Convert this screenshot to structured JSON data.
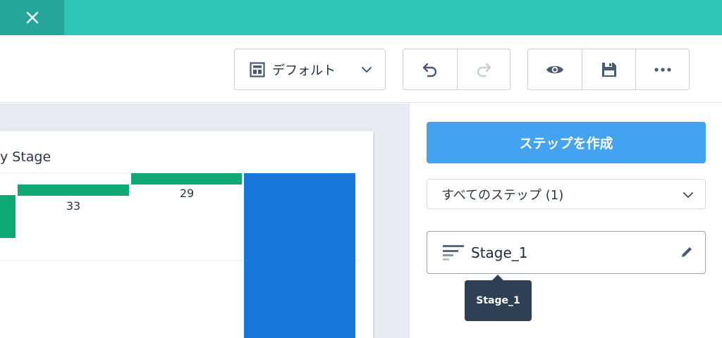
{
  "topbar": {
    "close_icon": "close-icon"
  },
  "toolbar": {
    "layout_dropdown": {
      "label": "デフォルト",
      "icon": "layout-icon"
    },
    "history": {
      "undo_icon": "undo-icon",
      "redo_icon": "redo-icon"
    },
    "actions": {
      "preview_icon": "eye-icon",
      "save_icon": "save-icon",
      "more_icon": "more-icon"
    }
  },
  "chart": {
    "title": "y Stage",
    "data_labels": [
      "33",
      "29"
    ]
  },
  "chart_data": {
    "type": "bar",
    "title": "y Stage",
    "data_labels": [
      "33",
      "29"
    ]
  },
  "right_panel": {
    "create_step_label": "ステップを作成",
    "steps_filter_label": "すべてのステップ (1)",
    "step": {
      "name": "Stage_1",
      "icon": "filter-lines-icon"
    },
    "tooltip": "Stage_1"
  },
  "colors": {
    "teal": "#2ec4b6",
    "green": "#0ea974",
    "blue": "#1877d9",
    "accent": "#43a3f0"
  }
}
